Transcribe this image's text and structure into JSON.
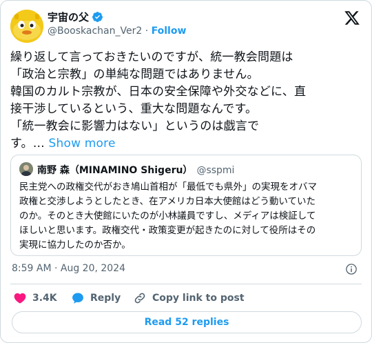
{
  "author": {
    "display_name": "宇宙の父",
    "handle": "@Booskachan_Ver2",
    "separator": "·",
    "follow_label": "Follow"
  },
  "tweet": {
    "text": "繰り返して言っておきたいのですが、統一教会問題は\n「政治と宗教」の単純な問題ではありません。\n韓国のカルト宗教が、日本の安全保障や外交などに、直\n接干渉しているという、重大な問題なんです。\n「統一教会に影響力はない」というのは戯言で\nす。… ",
    "show_more_label": "Show more"
  },
  "quote": {
    "name": "南野 森（MINAMINO Shigeru）",
    "handle": "@sspmi",
    "text": "民主党への政権交代がおき鳩山首相が「最低でも県外」の実現をオバマ\n政権と交渉しようとしたとき、在アメリカ日本大使館はどう動いていた\nのか。そのとき大使館にいたのが小林議員ですし、メディアは検証して\nほしいと思います。政権交代・政策変更が起きたのに対して役所はその\n実現に協力したのか否か。"
  },
  "meta": {
    "timestamp": "8:59 AM · Aug 20, 2024"
  },
  "actions": {
    "like_count": "3.4K",
    "reply_label": "Reply",
    "copy_link_label": "Copy link to post"
  },
  "footer": {
    "read_replies_label": "Read 52 replies"
  },
  "colors": {
    "accent": "#1d9bf0",
    "like": "#f91880",
    "muted": "#536471",
    "border": "#cfd9de"
  }
}
